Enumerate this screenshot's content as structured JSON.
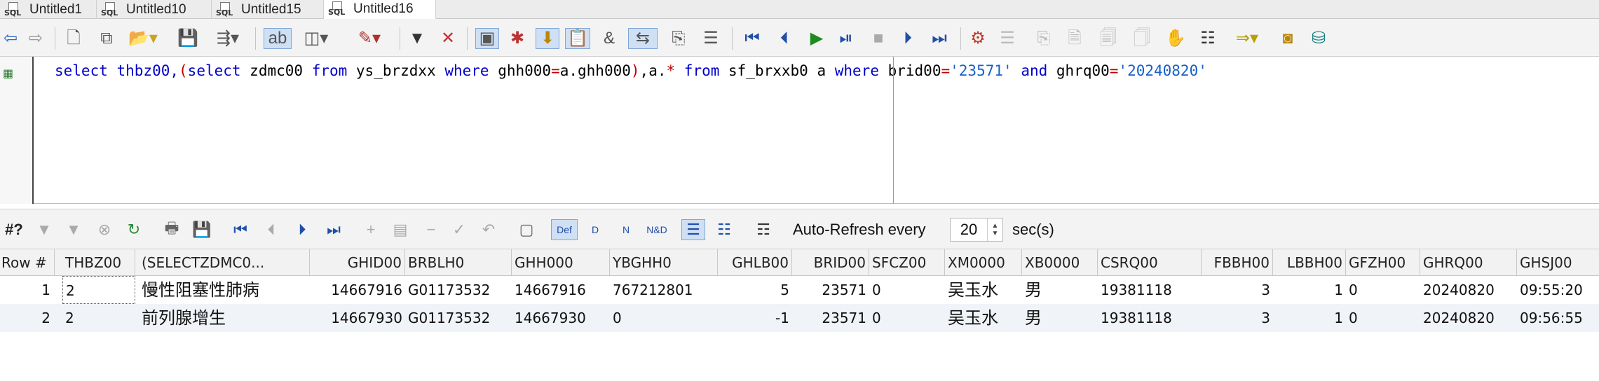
{
  "tabs": [
    {
      "icon": "sql-file-icon",
      "label": "Untitled1"
    },
    {
      "icon": "sql-file-icon",
      "label": "Untitled10"
    },
    {
      "icon": "sql-file-icon",
      "label": "Untitled15"
    },
    {
      "icon": "sql-file-icon",
      "label": "Untitled16"
    }
  ],
  "active_tab": "Untitled16",
  "editor": {
    "gutter_icon": "grid-icon",
    "sql": {
      "p1": "select thbz00,",
      "p2": "(",
      "p3": "select",
      "p4": " zdmc00 ",
      "p5": "from",
      "p6": " ys_brzdxx ",
      "p7": "where",
      "p8": " ghh000",
      "p9": "=",
      "p10": "a.ghh000",
      "p11": ")",
      "p12": ",a.",
      "p13": "*",
      "p14": " ",
      "p15": "from",
      "p16": " sf_brxxb0 a ",
      "p17": "where",
      "p18": " brid00",
      "p19": "=",
      "p20": "'23571'",
      "p21": " ",
      "p22": "and",
      "p23": " ghrq00",
      "p24": "=",
      "p25": "'20240820'"
    }
  },
  "grid_toolbar": {
    "rows_count_label": "#?",
    "auto_refresh_label": "Auto-Refresh every",
    "auto_refresh_value": "20",
    "sec_label": "sec(s)",
    "def_label": "Def"
  },
  "table": {
    "columns": [
      "Row #",
      "THBZ00",
      "(SELECTZDMC0...",
      "GHID00",
      "BRBLH0",
      "GHH000",
      "YBGHH0",
      "GHLB00",
      "BRID00",
      "SFCZ00",
      "XM0000",
      "XB0000",
      "CSRQ00",
      "FBBH00",
      "LBBH00",
      "GFZH00",
      "GHRQ00",
      "GHSJ00"
    ],
    "rows": [
      [
        "1",
        "2",
        "慢性阻塞性肺病",
        "14667916",
        "G01173532",
        "14667916",
        "767212801",
        "5",
        "23571",
        "0",
        "吴玉水",
        "男",
        "19381118",
        "3",
        "1",
        "0",
        "20240820",
        "09:55:20"
      ],
      [
        "2",
        "2",
        "前列腺增生",
        "14667930",
        "G01173532",
        "14667930",
        "0",
        "-1",
        "23571",
        "0",
        "吴玉水",
        "男",
        "19381118",
        "3",
        "1",
        "0",
        "20240820",
        "09:56:55"
      ]
    ]
  },
  "colors": {
    "keyword": "#0000cc",
    "operator": "#c00000",
    "string": "#1560c8",
    "selected_tool": "#cfe0f5"
  }
}
